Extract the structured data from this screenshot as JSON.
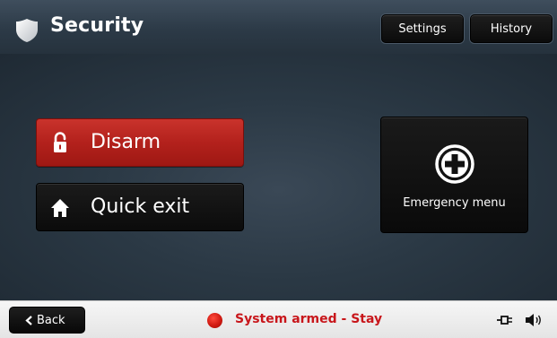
{
  "header": {
    "title": "Security",
    "icon": "shield-icon",
    "settings_label": "Settings",
    "history_label": "History"
  },
  "main": {
    "disarm": {
      "label": "Disarm",
      "icon": "unlocked-padlock-icon",
      "color": "#b3211c"
    },
    "quick_exit": {
      "label": "Quick exit",
      "icon": "home-icon"
    },
    "emergency": {
      "label": "Emergency menu",
      "icon": "plus-circle-icon"
    }
  },
  "footer": {
    "back_label": "Back",
    "status_text": "System armed - Stay",
    "status_color": "#c8161b",
    "icons": [
      "power-plug-icon",
      "speaker-icon"
    ]
  }
}
